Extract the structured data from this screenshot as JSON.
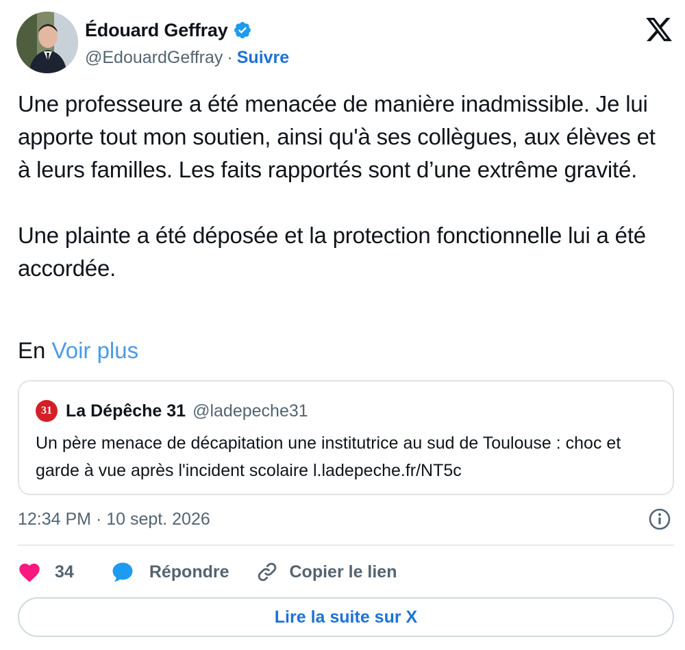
{
  "author": {
    "name": "Édouard Geffray",
    "handle": "@EdouardGeffray",
    "separator": "·",
    "follow_label": "Suivre",
    "verified": true
  },
  "tweet": {
    "paragraph_1": "Une professeure a été menacée de manière inadmissible. Je lui apporte tout mon soutien, ainsi qu'à ses collègues, aux élèves et à leurs familles. Les faits rapportés sont d’une extrême gravité.",
    "paragraph_2": "Une plainte a été déposée et la protection fonctionnelle lui a été accordée.",
    "truncated_prefix": "En",
    "see_more_label": "Voir plus"
  },
  "quote": {
    "logo_text": "31",
    "name": "La Dépêche 31",
    "handle": "@ladepeche31",
    "text": "Un père menace de décapitation une institutrice au sud de Toulouse : choc et garde à vue après l'incident scolaire l.ladepeche.fr/NT5c"
  },
  "timestamp": {
    "time": "12:34 PM",
    "separator": "·",
    "date": "10 sept. 2026"
  },
  "actions": {
    "likes_count": "34",
    "reply_label": "Répondre",
    "copy_link_label": "Copier le lien"
  },
  "read_more_label": "Lire la suite sur X",
  "colors": {
    "link_blue": "#1d72d6",
    "see_more_blue": "#4a9ae6",
    "verified_blue": "#1d9bf0",
    "like_pink": "#f91880",
    "reply_blue": "#1d9bf0",
    "muted_gray": "#536471",
    "quote_logo_red": "#d32027"
  },
  "icons": {
    "brand": "x-logo-icon",
    "verified": "verified-badge-icon",
    "info": "info-icon",
    "like": "heart-icon",
    "reply": "speech-bubble-icon",
    "copy_link": "link-icon"
  }
}
